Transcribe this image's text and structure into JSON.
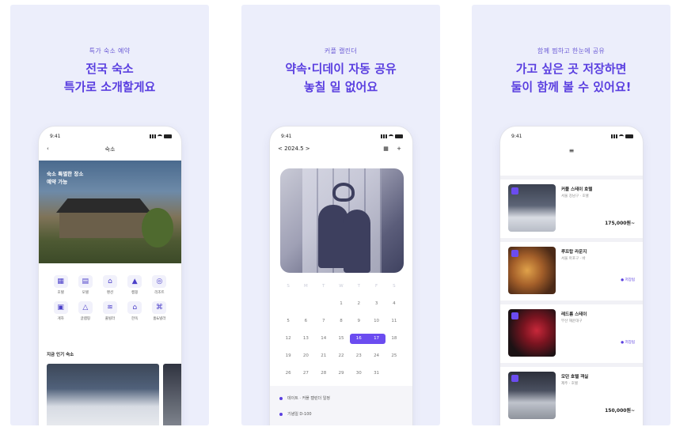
{
  "colors": {
    "accent": "#5a3fe0",
    "panel_bg": "#eceefb",
    "select": "#6b4cf0"
  },
  "panels": [
    {
      "kicker": "특가 숙소 예약",
      "headline_line1": "전국 숙소",
      "headline_line2": "특가로 소개할게요",
      "phone": {
        "time": "9:41",
        "nav_title": "숙소",
        "hero_caption_1": "숙소 특별한 장소",
        "hero_caption_2": "예약 가능",
        "categories": [
          "호텔",
          "모텔",
          "펜션",
          "캠핑",
          "리조트",
          "게하",
          "글램핑",
          "풀빌라",
          "한옥",
          "홈&빌라"
        ],
        "section_title": "지금 인기 숙소"
      }
    },
    {
      "kicker": "커플 캘린더",
      "headline_line1": "약속·디데이 자동 공유",
      "headline_line2": "놓칠 일 없어요",
      "phone": {
        "time": "9:41",
        "month_label": "< 2024.5 >",
        "nav_actions": "▦ +",
        "weekdays": [
          "S",
          "M",
          "T",
          "W",
          "T",
          "F",
          "S"
        ],
        "days": [
          "",
          "",
          "",
          "1",
          "2",
          "3",
          "4",
          "5",
          "6",
          "7",
          "8",
          "9",
          "10",
          "11",
          "12",
          "13",
          "14",
          "15",
          "16",
          "17",
          "18",
          "19",
          "20",
          "21",
          "22",
          "23",
          "24",
          "25",
          "26",
          "27",
          "28",
          "29",
          "30",
          "31",
          ""
        ],
        "events": [
          "데이트 · 커플 캘린더 일정",
          "기념일 D-100"
        ]
      }
    },
    {
      "kicker": "함께 찜하고 한눈에 공유",
      "headline_line1": "가고 싶은 곳 저장하면",
      "headline_line2": "둘이 함께 볼 수 있어요!",
      "phone": {
        "time": "9:41",
        "nav_title": "≡",
        "cards": [
          {
            "name": "커플 스테이 호텔",
            "sub": "서울 강남구 · 호텔",
            "tag": "",
            "price": "175,000원~"
          },
          {
            "name": "루프탑 라운지",
            "sub": "서울 마포구 · 바",
            "tag": "● 저장됨",
            "price": ""
          },
          {
            "name": "레드룸 스테이",
            "sub": "부산 해운대구",
            "tag": "● 저장됨",
            "price": ""
          },
          {
            "name": "모던 호텔 객실",
            "sub": "제주 · 호텔",
            "tag": "",
            "price": "150,000원~"
          }
        ]
      }
    }
  ]
}
